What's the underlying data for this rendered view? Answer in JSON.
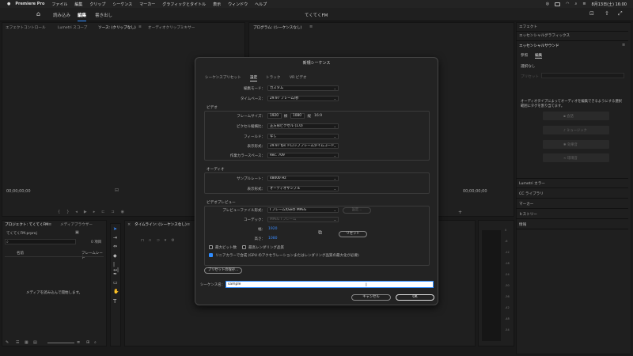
{
  "menubar": {
    "app": "Premiere Pro",
    "items": [
      "ファイル",
      "編集",
      "クリップ",
      "シーケンス",
      "マーカー",
      "グラフィックとタイトル",
      "表示",
      "ウィンドウ",
      "ヘルプ"
    ],
    "clock": "8月13日(土) 16:00"
  },
  "header": {
    "home_icon": "home-icon",
    "tabs": [
      "読み込み",
      "編集",
      "書き出し"
    ],
    "active_tab": "編集",
    "project_title": "てくてくFM"
  },
  "source_panel": {
    "tabs": [
      "エフェクトコントロール",
      "Lumetri スコープ",
      "ソース: (クリップなし)",
      "オーディオクリップミキサー"
    ],
    "timecode": "00;00;00;00"
  },
  "program_panel": {
    "title": "プログラム: (シーケンスなし)",
    "timecode": "00;00;00;00"
  },
  "right_panel": {
    "items": [
      "エフェクト",
      "エッセンシャルグラフィックス",
      "エッセンシャルサウンド"
    ],
    "subtabs": [
      "参照",
      "編集"
    ],
    "no_selection": "選択なし",
    "preset_label": "プリセット",
    "message": "オーディオタイプによってオーディオを編集できるようにする選択範囲にタグを割り当てます。",
    "type_buttons": [
      "会話",
      "ミュージック",
      "効果音",
      "環境音"
    ],
    "bottom_items": [
      "Lumetri カラー",
      "CC ライブラリ",
      "マーカー",
      "ヒストリー",
      "情報"
    ]
  },
  "project_panel": {
    "tabs": [
      "プロジェクト: てくてくFM",
      "メディアブラウザー"
    ],
    "file": "てくてくFM.prproj",
    "count": "0 項目",
    "columns": [
      "名前",
      "フレームレート"
    ],
    "empty_message": "メディアを読み込んで開始します。"
  },
  "timeline": {
    "title": "タイムライン: (シーケンスなし)"
  },
  "dialog": {
    "title": "新規シーケンス",
    "tabs": [
      "シーケンスプリセット",
      "設定",
      "トラック",
      "VR ビデオ"
    ],
    "active_tab": "設定",
    "edit_mode_label": "編集モード：",
    "edit_mode": "カスタム",
    "timebase_label": "タイムベース：",
    "timebase": "29.97 フレーム/秒",
    "video_group": "ビデオ",
    "frame_size_label": "フレームサイズ：",
    "frame_w": "1920",
    "h_label": "横",
    "frame_h": "1080",
    "v_label": "縦",
    "aspect": "16:9",
    "pixel_aspect_label": "ピクセル縦横比：",
    "pixel_aspect": "正方形ピクセル (1.0)",
    "fields_label": "フィールド：",
    "fields": "なし",
    "display_format_label": "表示形式：",
    "display_format": "29.97 fps ドロップフレームタイムコード",
    "color_space_label": "作業カラースペース：",
    "color_space": "Rec. 709",
    "audio_group": "オーディオ",
    "sample_rate_label": "サンプルレート：",
    "sample_rate": "48000 Hz",
    "audio_display_label": "表示形式：",
    "audio_display": "オーディオサンプル",
    "preview_group": "ビデオプレビュー",
    "preview_format_label": "プレビューファイル形式：",
    "preview_format": "I フレームのみの MPEG",
    "configure_button": "設定...",
    "codec_label": "コーデック：",
    "codec": "MPEG I フレーム",
    "width_label": "幅：",
    "width_value": "1920",
    "height_label": "高さ：",
    "height_value": "1080",
    "reset_button": "リセット",
    "max_bit_depth": "最大ビット数",
    "max_render_quality": "最高レンダリング品質",
    "linear_compositing": "リニアカラーで合成 (GPU のアクセラレーションまたはレンダリング品質の最大化が必要)",
    "save_preset_button": "プリセットの保存...",
    "sequence_name_label": "シーケンス名：",
    "sequence_name": "sample",
    "cancel_button": "キャンセル",
    "ok_button": "OK"
  },
  "meter_scale": [
    "0",
    "-6",
    "-12",
    "-18",
    "-24",
    "-30",
    "-36",
    "-42",
    "-48",
    "-54"
  ]
}
